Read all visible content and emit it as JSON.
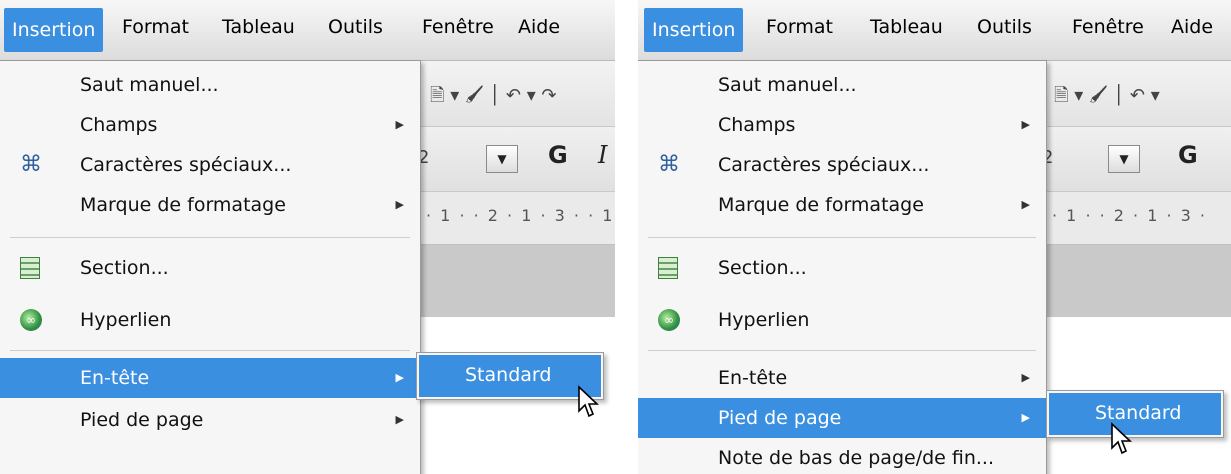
{
  "left": {
    "menubar": {
      "items": [
        {
          "label": "Insertion"
        },
        {
          "label": "Format"
        },
        {
          "label": "Tableau"
        },
        {
          "label": "Outils"
        },
        {
          "label": "Fenêtre"
        },
        {
          "label": "Aide"
        }
      ]
    },
    "toolbar": {
      "font_size_value": "2",
      "bold_label": "G",
      "italic_label": "I"
    },
    "ruler": {
      "text": "· 1 · · 2 · 1 · 3 · · 1 ·"
    },
    "menu": {
      "items": [
        {
          "label": "Saut manuel..."
        },
        {
          "label": "Champs"
        },
        {
          "label": "Caractères spéciaux..."
        },
        {
          "label": "Marque de formatage"
        },
        {
          "label": "Section..."
        },
        {
          "label": "Hyperlien"
        },
        {
          "label": "En-tête"
        },
        {
          "label": "Pied de page"
        }
      ]
    },
    "submenu": {
      "label": "Standard"
    }
  },
  "right": {
    "menubar": {
      "items": [
        {
          "label": "Insertion"
        },
        {
          "label": "Format"
        },
        {
          "label": "Tableau"
        },
        {
          "label": "Outils"
        },
        {
          "label": "Fenêtre"
        },
        {
          "label": "Aide"
        }
      ]
    },
    "toolbar": {
      "font_size_value": "2",
      "bold_label": "G"
    },
    "ruler": {
      "text": "· 1 · · 2 · 1 · 3 ·"
    },
    "menu": {
      "items": [
        {
          "label": "Saut manuel..."
        },
        {
          "label": "Champs"
        },
        {
          "label": "Caractères spéciaux..."
        },
        {
          "label": "Marque de formatage"
        },
        {
          "label": "Section..."
        },
        {
          "label": "Hyperlien"
        },
        {
          "label": "En-tête"
        },
        {
          "label": "Pied de page"
        },
        {
          "label": "Note de bas de page/de fin..."
        }
      ]
    },
    "submenu": {
      "label": "Standard"
    }
  },
  "colors": {
    "highlight": "#3b8fe0",
    "menu_bg": "#f6f6f6"
  },
  "icons": [
    "special-characters-icon",
    "section-icon",
    "hyperlink-icon",
    "submenu-arrow-icon",
    "mouse-cursor-icon"
  ]
}
